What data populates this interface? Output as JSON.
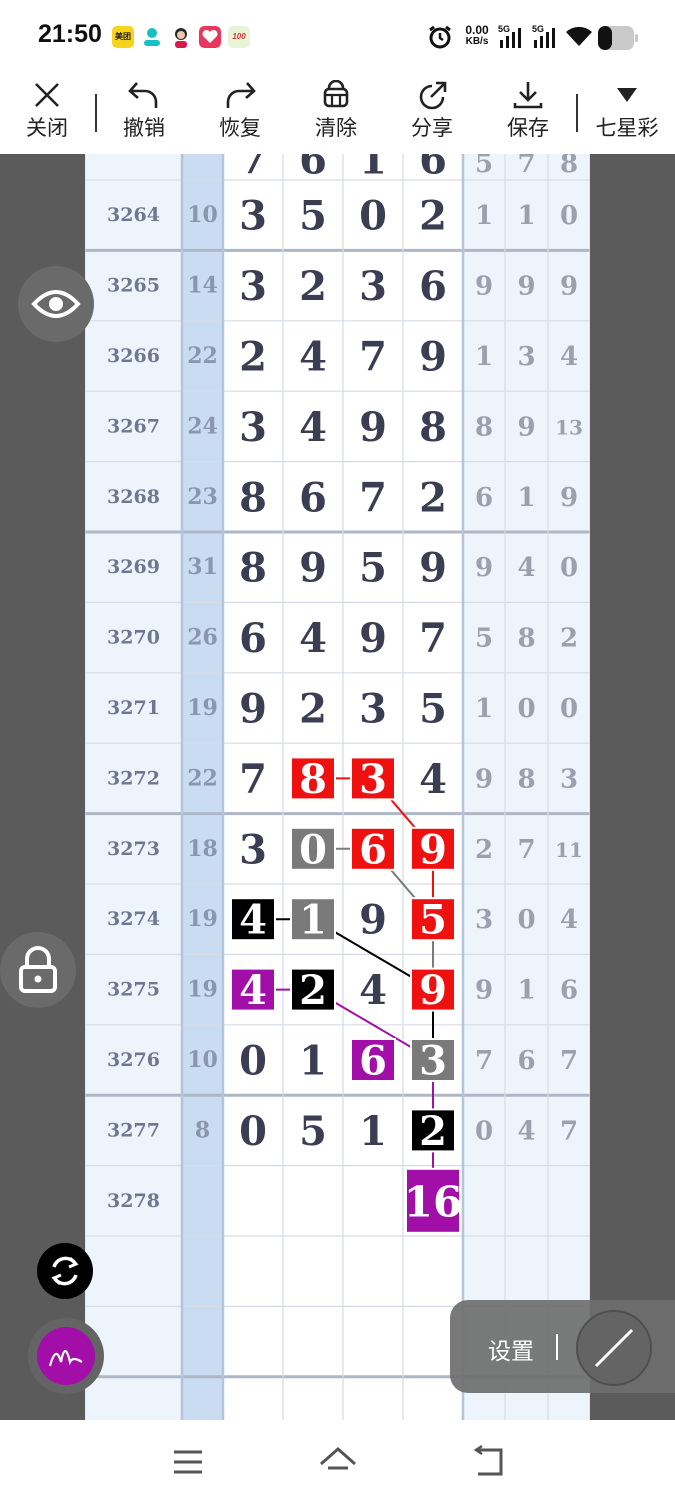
{
  "status_bar": {
    "time": "21:50",
    "app_icons": [
      "美团",
      "",
      "",
      "",
      "100"
    ],
    "net_rate_value": "0.00",
    "net_rate_unit": "KB/s",
    "sim1": "5G",
    "sim2": "5G"
  },
  "toolbar": {
    "close_label": "关闭",
    "undo_label": "撤销",
    "redo_label": "恢复",
    "clear_label": "清除",
    "share_label": "分享",
    "save_label": "保存",
    "lottery_label": "七星彩"
  },
  "table": {
    "partial_top_row": {
      "issue": "",
      "sum": "",
      "main": [
        "7",
        "6",
        "1",
        "6"
      ],
      "tail": [
        "5",
        "7",
        "8"
      ]
    },
    "rows": [
      {
        "issue": "3264",
        "sum": "10",
        "main": [
          "3",
          "5",
          "0",
          "2"
        ],
        "tail": [
          "1",
          "1",
          "0"
        ]
      },
      {
        "issue": "3265",
        "sum": "14",
        "main": [
          "3",
          "2",
          "3",
          "6"
        ],
        "tail": [
          "9",
          "9",
          "9"
        ]
      },
      {
        "issue": "3266",
        "sum": "22",
        "main": [
          "2",
          "4",
          "7",
          "9"
        ],
        "tail": [
          "1",
          "3",
          "4"
        ]
      },
      {
        "issue": "3267",
        "sum": "24",
        "main": [
          "3",
          "4",
          "9",
          "8"
        ],
        "tail": [
          "8",
          "9",
          "13"
        ]
      },
      {
        "issue": "3268",
        "sum": "23",
        "main": [
          "8",
          "6",
          "7",
          "2"
        ],
        "tail": [
          "6",
          "1",
          "9"
        ]
      },
      {
        "issue": "3269",
        "sum": "31",
        "main": [
          "8",
          "9",
          "5",
          "9"
        ],
        "tail": [
          "9",
          "4",
          "0"
        ]
      },
      {
        "issue": "3270",
        "sum": "26",
        "main": [
          "6",
          "4",
          "9",
          "7"
        ],
        "tail": [
          "5",
          "8",
          "2"
        ]
      },
      {
        "issue": "3271",
        "sum": "19",
        "main": [
          "9",
          "2",
          "3",
          "5"
        ],
        "tail": [
          "1",
          "0",
          "0"
        ]
      },
      {
        "issue": "3272",
        "sum": "22",
        "main": [
          "7",
          "8",
          "3",
          "4"
        ],
        "tail": [
          "9",
          "8",
          "3"
        ]
      },
      {
        "issue": "3273",
        "sum": "18",
        "main": [
          "3",
          "0",
          "6",
          "9"
        ],
        "tail": [
          "2",
          "7",
          "11"
        ]
      },
      {
        "issue": "3274",
        "sum": "19",
        "main": [
          "4",
          "1",
          "9",
          "5"
        ],
        "tail": [
          "3",
          "0",
          "4"
        ]
      },
      {
        "issue": "3275",
        "sum": "19",
        "main": [
          "4",
          "2",
          "4",
          "9"
        ],
        "tail": [
          "9",
          "1",
          "6"
        ]
      },
      {
        "issue": "3276",
        "sum": "10",
        "main": [
          "0",
          "1",
          "6",
          "3"
        ],
        "tail": [
          "7",
          "6",
          "7"
        ]
      },
      {
        "issue": "3277",
        "sum": "8",
        "main": [
          "0",
          "5",
          "1",
          "2"
        ],
        "tail": [
          "0",
          "4",
          "7"
        ]
      },
      {
        "issue": "3278",
        "sum": "",
        "main": [
          "",
          "",
          "",
          "16"
        ],
        "tail": [
          "",
          "",
          ""
        ]
      }
    ]
  },
  "markers": [
    {
      "row": 8,
      "col": 1,
      "color": "#ef1010"
    },
    {
      "row": 8,
      "col": 2,
      "color": "#ef1010"
    },
    {
      "row": 9,
      "col": 1,
      "color": "#7a7a7a"
    },
    {
      "row": 9,
      "col": 2,
      "color": "#ef1010"
    },
    {
      "row": 9,
      "col": 3,
      "color": "#ef1010"
    },
    {
      "row": 10,
      "col": 0,
      "color": "#000000"
    },
    {
      "row": 10,
      "col": 1,
      "color": "#7a7a7a"
    },
    {
      "row": 10,
      "col": 3,
      "color": "#ef1010"
    },
    {
      "row": 11,
      "col": 0,
      "color": "#a10ea8"
    },
    {
      "row": 11,
      "col": 1,
      "color": "#000000"
    },
    {
      "row": 11,
      "col": 3,
      "color": "#ef1010"
    },
    {
      "row": 12,
      "col": 2,
      "color": "#a10ea8"
    },
    {
      "row": 12,
      "col": 3,
      "color": "#7a7a7a"
    },
    {
      "row": 13,
      "col": 3,
      "color": "#000000"
    },
    {
      "row": 14,
      "col": 3,
      "color": "#a10ea8"
    }
  ],
  "connectors": [
    {
      "color": "#ef1010",
      "cells": [
        [
          8,
          1
        ],
        [
          8,
          2
        ],
        [
          9,
          3
        ],
        [
          10,
          3
        ],
        [
          11,
          3
        ]
      ]
    },
    {
      "color": "#7a7a7a",
      "cells": [
        [
          9,
          1
        ],
        [
          9,
          2
        ],
        [
          10,
          3
        ],
        [
          12,
          3
        ]
      ]
    },
    {
      "color": "#000000",
      "cells": [
        [
          10,
          0
        ],
        [
          10,
          1
        ],
        [
          11,
          3
        ],
        [
          13,
          3
        ]
      ]
    },
    {
      "color": "#a10ea8",
      "cells": [
        [
          11,
          0
        ],
        [
          11,
          1
        ],
        [
          12,
          3
        ],
        [
          14,
          3
        ]
      ]
    }
  ],
  "colors": {
    "accent_purple": "#a10ea8",
    "marker_red": "#ef1010",
    "marker_gray": "#7a7a7a",
    "marker_black": "#000000",
    "number_main": "#3b3d52",
    "number_tail": "#9aa1ad",
    "issue_text": "#6d7890",
    "grid_line": "#d6dde6",
    "group_line": "#aeb7c6",
    "sum_column": "#c9dcf2"
  },
  "overlay": {
    "eye_icon": "eye-icon",
    "lock_icon": "lock-icon",
    "refresh_icon": "refresh-icon",
    "pen_icon": "signature-pen-icon",
    "settings_label": "设置",
    "settings_sep": "|"
  },
  "nav": {
    "menu_icon": "menu-icon",
    "home_icon": "home-icon",
    "back_icon": "back-icon"
  }
}
